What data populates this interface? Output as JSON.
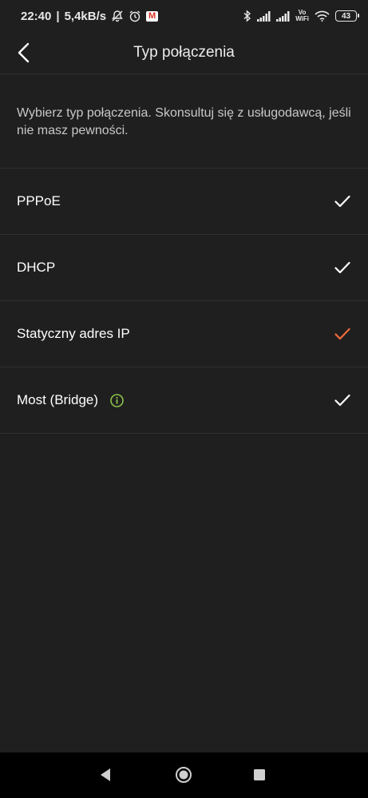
{
  "status_bar": {
    "time": "22:40",
    "speed": "5,4kB/s",
    "separator": "|",
    "gmail_letter": "M",
    "volte_top": "Vo",
    "volte_bottom": "WiFi",
    "battery": "43",
    "icons": [
      "alarm-off-icon",
      "alarm-icon",
      "gmail-icon",
      "bluetooth-icon",
      "signal-icon",
      "signal-icon",
      "vowifi-icon",
      "wifi-icon",
      "battery-icon"
    ]
  },
  "header": {
    "title": "Typ połączenia",
    "back_icon": "chevron-left-icon"
  },
  "description": "Wybierz typ połączenia. Skonsultuj się z usługodawcą, jeśli nie masz pewności.",
  "options": [
    {
      "label": "PPPoE",
      "selected": false
    },
    {
      "label": "DHCP",
      "selected": false
    },
    {
      "label": "Statyczny adres IP",
      "selected": true
    },
    {
      "label": "Most (Bridge)",
      "selected": false,
      "info_icon": "info-icon"
    }
  ],
  "colors": {
    "background": "#1f1f1f",
    "accent": "#f26b3a",
    "check_default": "#ffffff",
    "info_green": "#8bc34a"
  },
  "navbar": {
    "icons": [
      "back-triangle-icon",
      "home-circle-icon",
      "recents-square-icon"
    ]
  }
}
